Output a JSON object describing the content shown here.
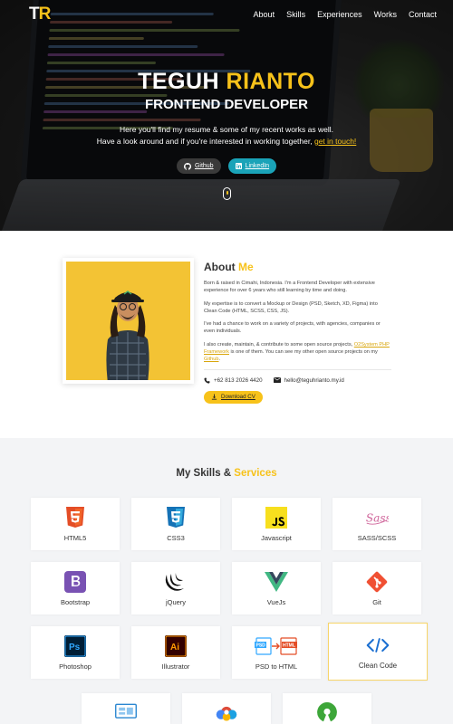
{
  "nav": {
    "logo_t": "T",
    "logo_r": "R",
    "links": [
      "About",
      "Skills",
      "Experiences",
      "Works",
      "Contact"
    ]
  },
  "hero": {
    "first_name": "TEGUH",
    "last_name": "RIANTO",
    "role": "FRONTEND DEVELOPER",
    "intro_line1": "Here you'll find my resume & some of my recent works as well.",
    "intro_line2": "Have a look around and if you're interested in working together,",
    "intro_cta": "get in touch!",
    "github_label": "Github",
    "linkedin_label": "LinkedIn"
  },
  "about": {
    "title_prefix": "About",
    "title_hl": "Me",
    "p1": "Born & raised in Cimahi, Indonesia. I'm a Frontend Developer with extensive experience for over 6 years who still learning by time and doing.",
    "p2": "My expertise is to convert a Mockup or Design (PSD, Sketch, XD, Figma) into Clean Code (HTML, SCSS, CSS, JS).",
    "p3": "I've had a chance to work on a variety of projects, with agencies, companies or even individuals.",
    "p4_a": "I also create, maintain, & contribute to some open source projects,",
    "p4_link1": "O2System PHP Framework",
    "p4_b": "is one of them. You can see my other open source projects on my",
    "p4_link2": "Github",
    "p4_c": ".",
    "phone": "+62 813 2026 4420",
    "email": "hello@teguhrianto.my.id",
    "cv_label": "Download CV"
  },
  "skills": {
    "title_prefix": "My Skills &",
    "title_hl": "Services",
    "items": [
      "HTML5",
      "CSS3",
      "Javascript",
      "SASS/SCSS",
      "Bootstrap",
      "jQuery",
      "VueJs",
      "Git",
      "Photoshop",
      "Illustrator",
      "PSD to HTML",
      "Clean Code"
    ]
  },
  "colors": {
    "accent": "#f7c21a",
    "linkedin": "#1aa3b8"
  }
}
